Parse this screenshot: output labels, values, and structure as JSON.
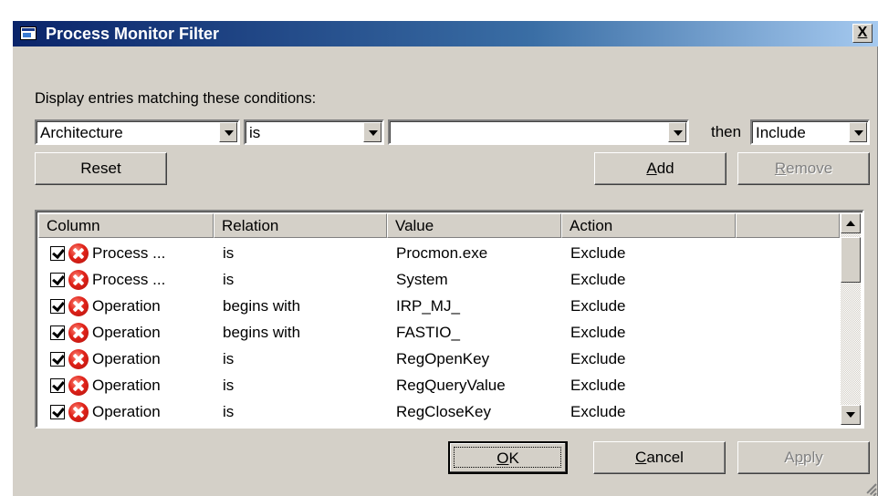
{
  "window": {
    "title": "Process Monitor Filter",
    "close_label": "X"
  },
  "filter": {
    "label": "Display entries matching these conditions:",
    "column_value": "Architecture",
    "relation_value": "is",
    "value_value": "",
    "then_label": "then",
    "action_value": "Include"
  },
  "buttons": {
    "reset": "Reset",
    "add_mnemonic": "A",
    "add_rest": "dd",
    "remove_mnemonic": "R",
    "remove_rest": "emove",
    "ok_mnemonic": "O",
    "ok_rest": "K",
    "cancel_mnemonic": "C",
    "cancel_rest": "ancel",
    "apply_pre": "A",
    "apply_mnemonic": "p",
    "apply_post": "ply"
  },
  "table": {
    "headers": [
      "Column",
      "Relation",
      "Value",
      "Action",
      ""
    ],
    "rows": [
      {
        "column": "Process ...",
        "relation": "is",
        "value": "Procmon.exe",
        "action": "Exclude"
      },
      {
        "column": "Process ...",
        "relation": "is",
        "value": "System",
        "action": "Exclude"
      },
      {
        "column": "Operation",
        "relation": "begins with",
        "value": "IRP_MJ_",
        "action": "Exclude"
      },
      {
        "column": "Operation",
        "relation": "begins with",
        "value": "FASTIO_",
        "action": "Exclude"
      },
      {
        "column": "Operation",
        "relation": "is",
        "value": "RegOpenKey",
        "action": "Exclude"
      },
      {
        "column": "Operation",
        "relation": "is",
        "value": "RegQueryValue",
        "action": "Exclude"
      },
      {
        "column": "Operation",
        "relation": "is",
        "value": "RegCloseKey",
        "action": "Exclude"
      }
    ]
  },
  "icons": {
    "app": "window-icon",
    "checkbox": "checkbox-checked-icon",
    "exclude": "red-x-exclude-icon",
    "dropdown": "chevron-down-icon"
  },
  "colors": {
    "titlebar_start": "#0a246a",
    "titlebar_end": "#a6caf0",
    "dialog_bg": "#d4d0c8",
    "exclude_red": "#e0231a"
  }
}
